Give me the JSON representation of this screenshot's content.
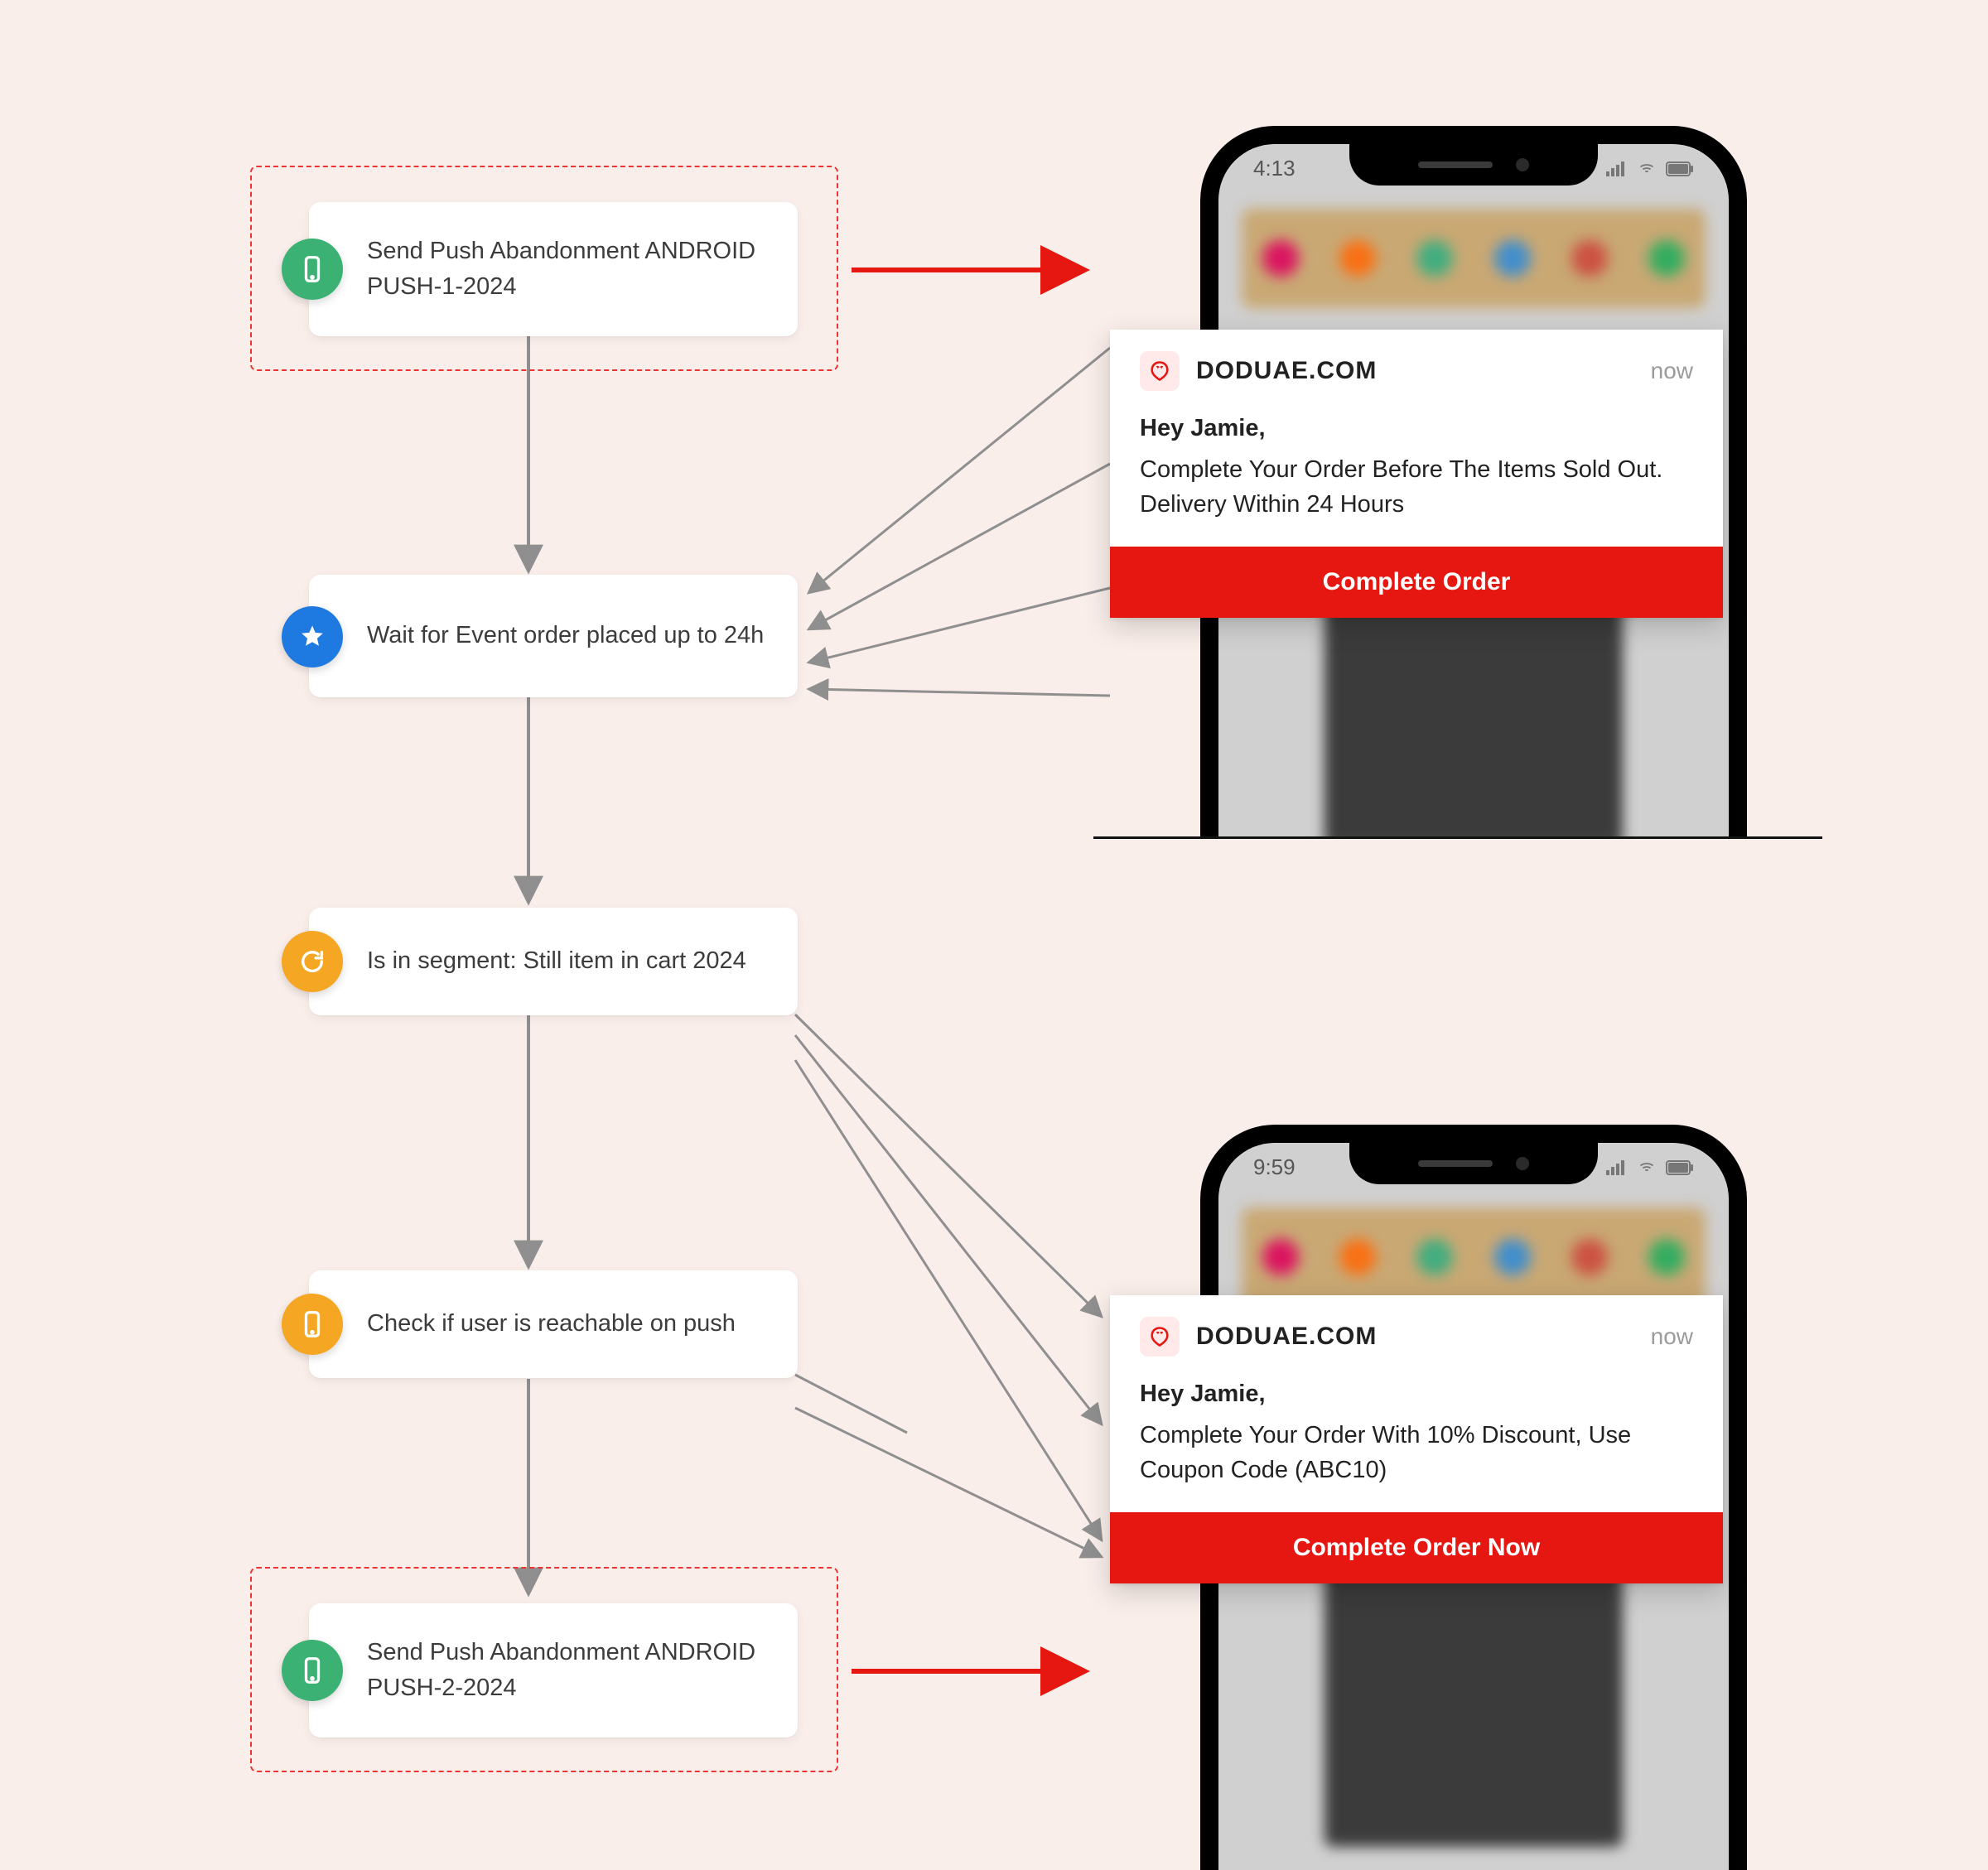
{
  "flow": {
    "step1": {
      "label": "Send Push Abandonment ANDROID PUSH-1-2024",
      "icon": "phone-icon",
      "color": "green"
    },
    "step2": {
      "label": "Wait for Event order placed up to 24h",
      "icon": "star-icon",
      "color": "blue"
    },
    "step3": {
      "label": "Is in segment: Still item in cart 2024",
      "icon": "refresh-icon",
      "color": "orange"
    },
    "step4": {
      "label": "Check if user is reachable on push",
      "icon": "phone-icon",
      "color": "orange"
    },
    "step5": {
      "label": "Send Push Abandonment ANDROID PUSH-2-2024",
      "icon": "phone-icon",
      "color": "green"
    }
  },
  "phone1": {
    "time": "4:13"
  },
  "phone2": {
    "time": "9:59"
  },
  "push1": {
    "app": "DODUAE.COM",
    "time": "now",
    "greeting": "Hey Jamie,",
    "body": "Complete Your Order Before The Items Sold Out. Delivery Within 24 Hours",
    "cta": "Complete Order"
  },
  "push2": {
    "app": "DODUAE.COM",
    "time": "now",
    "greeting": "Hey Jamie,",
    "body": "Complete Your Order With 10% Discount, Use Coupon Code (ABC10)",
    "cta": "Complete Order Now"
  },
  "colors": {
    "accent_red": "#e61610",
    "orange": "#f5a623",
    "green": "#3bb273",
    "blue": "#1e7ae0"
  }
}
